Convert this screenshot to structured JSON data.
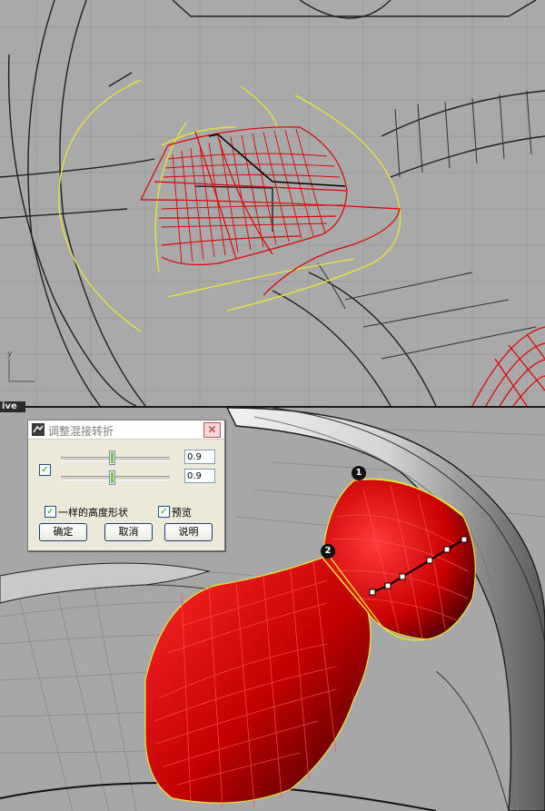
{
  "viewport_top": {
    "axis_label": "y"
  },
  "viewport_bottom": {
    "tab_label": "ive"
  },
  "dialog": {
    "title": "调整混接转折",
    "slider1_value": "0.9",
    "slider2_value": "0.9",
    "same_height_label": "一样的高度形状",
    "preview_label": "预览",
    "ok_label": "确定",
    "cancel_label": "取消",
    "help_label": "说明",
    "close_glyph": "✕",
    "check_glyph": "✓"
  },
  "markers": {
    "m1": "1",
    "m2": "2"
  },
  "colors": {
    "curve_red": "#e00000",
    "curve_yellow": "#e8e830",
    "surface_red": "#d10000"
  }
}
